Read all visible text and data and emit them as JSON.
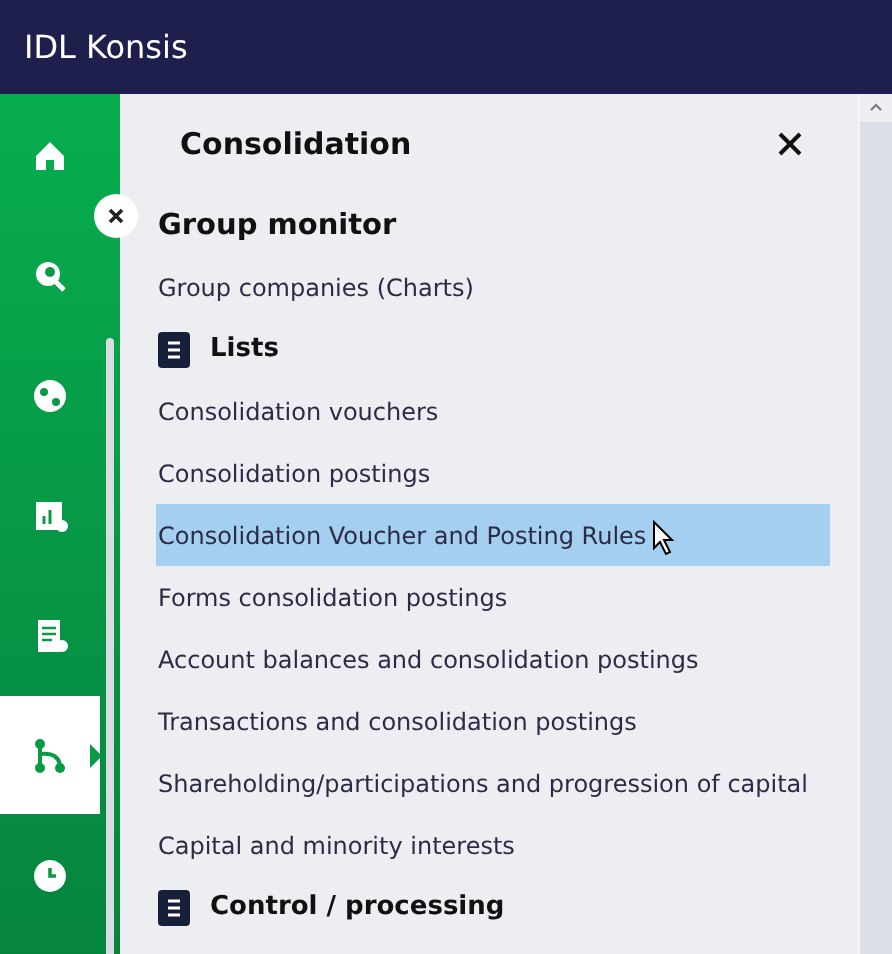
{
  "header": {
    "title": "IDL Konsis"
  },
  "rail": [
    {
      "selected": false
    },
    {
      "selected": false
    },
    {
      "selected": false
    },
    {
      "selected": false
    },
    {
      "selected": false
    },
    {
      "selected": true
    },
    {
      "selected": false
    }
  ],
  "panel": {
    "title": "Consolidation",
    "items": [
      {
        "kind": "heading",
        "label": "Group monitor",
        "selected": false
      },
      {
        "kind": "link",
        "label": "Group companies (Charts)",
        "selected": false
      },
      {
        "kind": "section",
        "label": "Lists",
        "selected": false
      },
      {
        "kind": "link",
        "label": "Consolidation vouchers",
        "selected": false
      },
      {
        "kind": "link",
        "label": "Consolidation postings",
        "selected": false
      },
      {
        "kind": "link",
        "label": "Consolidation Voucher and Posting Rules",
        "selected": true
      },
      {
        "kind": "link",
        "label": "Forms consolidation postings",
        "selected": false
      },
      {
        "kind": "link",
        "label": "Account balances and consolidation postings",
        "selected": false
      },
      {
        "kind": "link",
        "label": "Transactions and consolidation postings",
        "selected": false
      },
      {
        "kind": "link",
        "label": "Shareholding/participations and progression of capital",
        "selected": false
      },
      {
        "kind": "link",
        "label": "Capital and minority interests",
        "selected": false
      },
      {
        "kind": "section",
        "label": "Control / processing",
        "selected": false
      }
    ]
  }
}
